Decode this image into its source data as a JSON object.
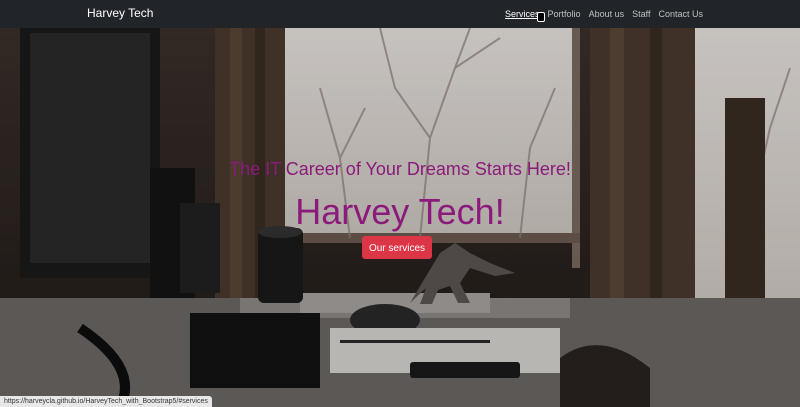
{
  "navbar": {
    "brand": "Harvey Tech",
    "items": [
      {
        "label": "Services",
        "active": true
      },
      {
        "label": "Portfolio"
      },
      {
        "label": "About us"
      },
      {
        "label": "Staff"
      },
      {
        "label": "Contact Us"
      }
    ]
  },
  "hero": {
    "tagline": "The IT Career of Your Dreams Starts Here!",
    "title": "Harvey Tech!",
    "cta_label": "Our services",
    "text_color": "#8b1a7a",
    "button_color": "#dc3545"
  },
  "status_bar": {
    "url": "https://harveycla.github.io/HarveyTech_with_Bootstrap5/#services"
  },
  "colors": {
    "navbar_bg": "#212529"
  }
}
